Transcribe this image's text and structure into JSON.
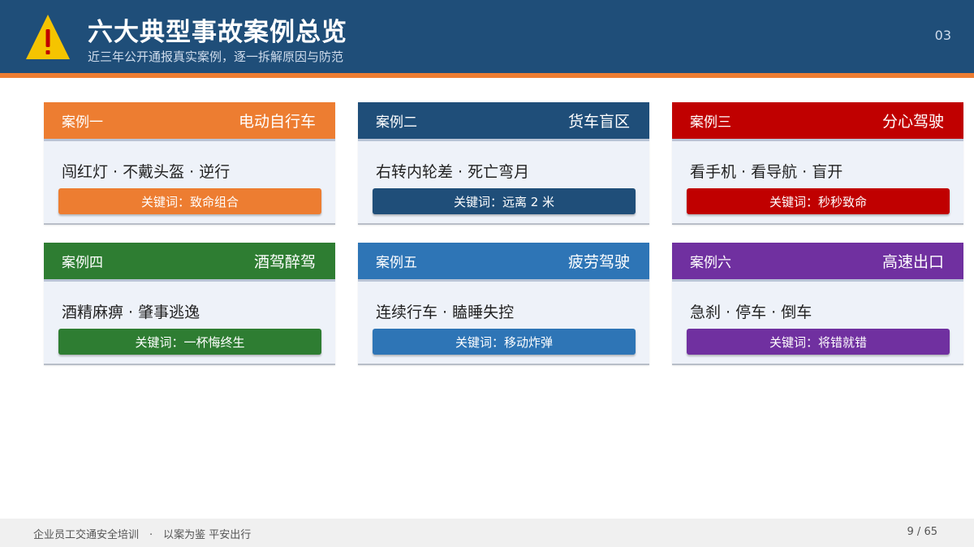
{
  "header": {
    "title": "六大典型事故案例总览",
    "subtitle": "近三年公开通报真实案例，逐一拆解原因与防范",
    "page_number": "03",
    "icon": "warning-triangle-icon"
  },
  "colors": {
    "header_bg": "#1f4e79",
    "header_stripe": "#ed7d31",
    "card_bg": "#eef2f9"
  },
  "cases": [
    {
      "label": "案例一",
      "category": "电动自行车",
      "description": "闯红灯 · 不戴头盔 · 逆行",
      "keyword": "关键词：致命组合",
      "color": "#ed7d31"
    },
    {
      "label": "案例二",
      "category": "货车盲区",
      "description": "右转内轮差 · 死亡弯月",
      "keyword": "关键词：远离 2 米",
      "color": "#1f4e79"
    },
    {
      "label": "案例三",
      "category": "分心驾驶",
      "description": "看手机 · 看导航 · 盲开",
      "keyword": "关键词：秒秒致命",
      "color": "#c00000"
    },
    {
      "label": "案例四",
      "category": "酒驾醉驾",
      "description": "酒精麻痹 · 肇事逃逸",
      "keyword": "关键词：一杯悔终生",
      "color": "#2e7d32"
    },
    {
      "label": "案例五",
      "category": "疲劳驾驶",
      "description": "连续行车 · 瞌睡失控",
      "keyword": "关键词：移动炸弹",
      "color": "#2e75b6"
    },
    {
      "label": "案例六",
      "category": "高速出口",
      "description": "急刹 · 停车 · 倒车",
      "keyword": "关键词：将错就错",
      "color": "#7030a0"
    }
  ],
  "footer": {
    "left": "企业员工交通安全培训　·　以案为鉴  平安出行",
    "right": "9 / 65"
  }
}
